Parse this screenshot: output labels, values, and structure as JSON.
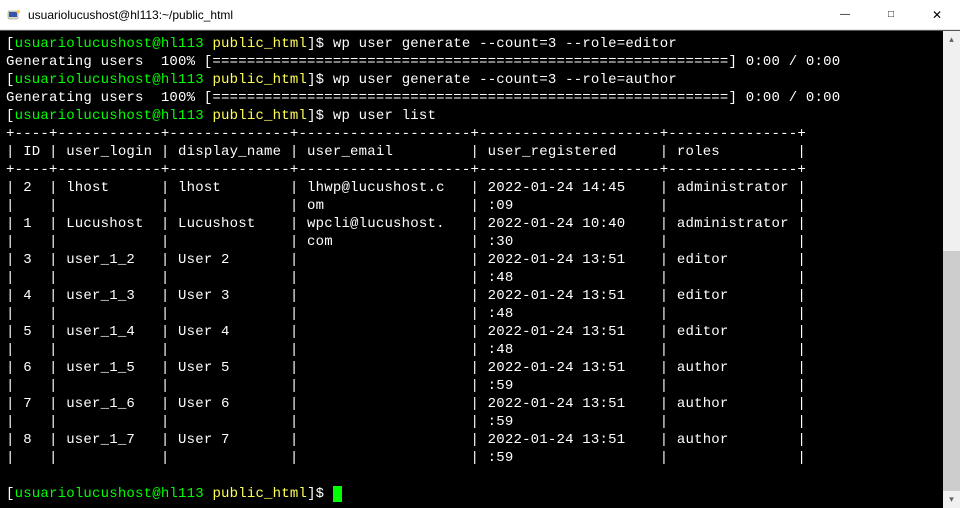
{
  "window": {
    "title": "usuariolucushost@hl113:~/public_html"
  },
  "term": {
    "prompt_user": "usuariolucushost@hl113",
    "prompt_path": "public_html",
    "cmd1": "wp user generate --count=3 --role=editor",
    "cmd2": "wp user generate --count=3 --role=author",
    "cmd3": "wp user list",
    "gen_prefix": "Generating users  100% ",
    "gen_bar": "[============================================================]",
    "gen_time": " 0:00 / 0:00",
    "table": {
      "border_top": "+----+------------+--------------+--------------------+---------------------+---------------+",
      "header": "| ID | user_login | display_name | user_email         | user_registered     | roles         |",
      "border_mid": "+----+------------+--------------+--------------------+---------------------+---------------+",
      "rows": [
        "| 2  | lhost      | lhost        | lhwp@lucushost.c   | 2022-01-24 14:45    | administrator |",
        "|    |            |              | om                 | :09                 |               |",
        "| 1  | Lucushost  | Lucushost    | wpcli@lucushost.   | 2022-01-24 10:40    | administrator |",
        "|    |            |              | com                | :30                 |               |",
        "| 3  | user_1_2   | User 2       |                    | 2022-01-24 13:51    | editor        |",
        "|    |            |              |                    | :48                 |               |",
        "| 4  | user_1_3   | User 3       |                    | 2022-01-24 13:51    | editor        |",
        "|    |            |              |                    | :48                 |               |",
        "| 5  | user_1_4   | User 4       |                    | 2022-01-24 13:51    | editor        |",
        "|    |            |              |                    | :48                 |               |",
        "| 6  | user_1_5   | User 5       |                    | 2022-01-24 13:51    | author        |",
        "|    |            |              |                    | :59                 |               |",
        "| 7  | user_1_6   | User 6       |                    | 2022-01-24 13:51    | author        |",
        "|    |            |              |                    | :59                 |               |",
        "| 8  | user_1_7   | User 7       |                    | 2022-01-24 13:51    | author        |",
        "|    |            |              |                    | :59                 |               |"
      ]
    }
  },
  "chart_data": {
    "type": "table",
    "title": "wp user list",
    "columns": [
      "ID",
      "user_login",
      "display_name",
      "user_email",
      "user_registered",
      "roles"
    ],
    "rows": [
      {
        "ID": 2,
        "user_login": "lhost",
        "display_name": "lhost",
        "user_email": "lhwp@lucushost.com",
        "user_registered": "2022-01-24 14:45:09",
        "roles": "administrator"
      },
      {
        "ID": 1,
        "user_login": "Lucushost",
        "display_name": "Lucushost",
        "user_email": "wpcli@lucushost.com",
        "user_registered": "2022-01-24 10:40:30",
        "roles": "administrator"
      },
      {
        "ID": 3,
        "user_login": "user_1_2",
        "display_name": "User 2",
        "user_email": "",
        "user_registered": "2022-01-24 13:51:48",
        "roles": "editor"
      },
      {
        "ID": 4,
        "user_login": "user_1_3",
        "display_name": "User 3",
        "user_email": "",
        "user_registered": "2022-01-24 13:51:48",
        "roles": "editor"
      },
      {
        "ID": 5,
        "user_login": "user_1_4",
        "display_name": "User 4",
        "user_email": "",
        "user_registered": "2022-01-24 13:51:48",
        "roles": "editor"
      },
      {
        "ID": 6,
        "user_login": "user_1_5",
        "display_name": "User 5",
        "user_email": "",
        "user_registered": "2022-01-24 13:51:59",
        "roles": "author"
      },
      {
        "ID": 7,
        "user_login": "user_1_6",
        "display_name": "User 6",
        "user_email": "",
        "user_registered": "2022-01-24 13:51:59",
        "roles": "author"
      },
      {
        "ID": 8,
        "user_login": "user_1_7",
        "display_name": "User 7",
        "user_email": "",
        "user_registered": "2022-01-24 13:51:59",
        "roles": "author"
      }
    ]
  }
}
